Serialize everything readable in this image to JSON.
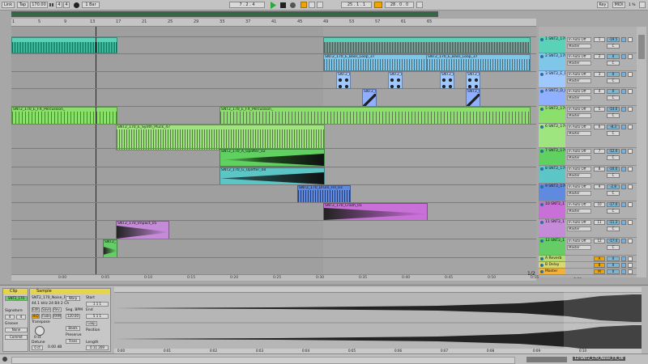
{
  "topbar": {
    "link": "Link",
    "tap": "Tap",
    "tempo": "170.00",
    "sig_num": "4",
    "sig_den": "4",
    "quantize": "1 Bar",
    "position": "7 .  2 .  4",
    "loop_start": "25 .  1 .  1",
    "loop_len": "28 .  0 .  0",
    "key": "Key",
    "midi": "MIDI",
    "cpu": "1 %"
  },
  "ruler": {
    "bars": [
      "1",
      "5",
      "9",
      "13",
      "17",
      "21",
      "25",
      "29",
      "33",
      "37",
      "41",
      "45",
      "49",
      "53",
      "57",
      "61",
      "65"
    ]
  },
  "timebar": {
    "times": [
      "0:00",
      "0:05",
      "0:10",
      "0:15",
      "0:20",
      "0:25",
      "0:30",
      "0:35",
      "0:40",
      "0:45",
      "0:50",
      "0:55",
      "1:00"
    ],
    "page": "1/2"
  },
  "tracks": [
    {
      "num": "1",
      "name": "1 SNT2_170",
      "color": "#5ad2b8",
      "vol": "-19.5",
      "pan": "C",
      "mon": "Master"
    },
    {
      "num": "2",
      "name": "2 SNT2_170",
      "color": "#7fc6e8",
      "vol": "0",
      "pan": "C",
      "mon": "Master"
    },
    {
      "num": "3",
      "name": "3 SNT2_E_B",
      "color": "#9fc8ff",
      "vol": "0",
      "pan": "C",
      "mon": "Master"
    },
    {
      "num": "4",
      "name": "4 SNT2_D_B",
      "color": "#8fb0ff",
      "vol": "0",
      "pan": "C",
      "mon": "Master"
    },
    {
      "num": "5",
      "name": "5 SNT2_170",
      "color": "#8ae06a",
      "vol": "-14.0",
      "pan": "C",
      "mon": "Master"
    },
    {
      "num": "6",
      "name": "6 SNT2_170",
      "color": "#9ee57f",
      "vol": "-8.3",
      "pan": "C",
      "mon": "Master"
    },
    {
      "num": "7",
      "name": "7 SNT2_170",
      "color": "#60d060",
      "vol": "-12.0",
      "pan": "C",
      "mon": "Master"
    },
    {
      "num": "8",
      "name": "8 SNT2_170",
      "color": "#5cc6c6",
      "vol": "-10.0",
      "pan": "C",
      "mon": "Master"
    },
    {
      "num": "9",
      "name": "9 SNT2_170",
      "color": "#5f8ae0",
      "vol": "-2.8",
      "pan": "C",
      "mon": "Master"
    },
    {
      "num": "10",
      "name": "10 SNT2_17",
      "color": "#c86fd8",
      "vol": "-17.0",
      "pan": "C",
      "mon": "Master"
    },
    {
      "num": "11",
      "name": "11 SNT2_17",
      "color": "#c58ad8",
      "vol": "-11.3",
      "pan": "C",
      "mon": "Master"
    },
    {
      "num": "12",
      "name": "12 SNT2_17",
      "color": "#66cc66",
      "vol": "-17.4",
      "pan": "C",
      "mon": "Master"
    },
    {
      "num": "A",
      "name": "A Reverb",
      "color": "#b8d873",
      "vol": "0",
      "pan": "C",
      "mon": "Post"
    },
    {
      "num": "B",
      "name": "B Delay",
      "color": "#d8d873",
      "vol": "0",
      "pan": "C",
      "mon": "Post"
    },
    {
      "num": "M",
      "name": "Master",
      "color": "#f2b13c",
      "vol": "0",
      "pan": "C",
      "mon": "1/2"
    }
  ],
  "clips": [
    {
      "label": "SNT2_170_E_Bass_Loop_37",
      "color": "#5ad2b8"
    },
    {
      "label": "SNT2_170_E_Bass_Loop_37",
      "color": "#7fc6e8"
    },
    {
      "label": "SNT2_170_E_Bass_Loop_37",
      "color": "#7fc6e8"
    },
    {
      "label": "SNT2_E",
      "color": "#9fc8ff"
    },
    {
      "label": "SNT2_D",
      "color": "#8fb0ff"
    },
    {
      "label": "SNT2_170_E_FX_Percussion_",
      "color": "#8ae06a"
    },
    {
      "label": "SNT2_170_E_Synth_Pluck_47",
      "color": "#9ee57f"
    },
    {
      "label": "SNT2_170_A_Uplifter_02",
      "color": "#60d060"
    },
    {
      "label": "SNT2_170_G_Uplifter_08",
      "color": "#5cc6c6"
    },
    {
      "label": "SNT2_170_Drum_Fill_03",
      "color": "#5f8ae0"
    },
    {
      "label": "SNT2_170_Crash_01",
      "color": "#c86fd8"
    },
    {
      "label": "SNT2_170_Impact_05",
      "color": "#c58ad8"
    },
    {
      "label": "SNT2_",
      "color": "#66cc66"
    }
  ],
  "detail": {
    "clip_title": "Clip",
    "clip_name": "SNT2_170",
    "signature": "Signature",
    "sig_num": "4",
    "sig_den": "4",
    "groove": "Groove",
    "groove_val": "None",
    "commit": "Commit",
    "sample_title": "Sample",
    "sample_name": "SNT2_170_Noise_F",
    "sample_info": "44.1 kHz 24 Bit 2 Ch",
    "edit": "Edit",
    "save": "Save",
    "rev": "Rev.",
    "hiq": "HiQ",
    "fade": "Fade",
    "ram": "RAM",
    "transpose": "Transpose",
    "transpose_val": "0 st",
    "detune": "Detune",
    "detune_val": "0 ct",
    "gain": "0.00 dB",
    "warp": "Warp",
    "seg_bpm": "Seg. BPM",
    "seg_val": "120.00",
    "beats": "Beats",
    "preserve": "Preserve",
    "trans": "Trans",
    "start": "Start",
    "start_val": "1 1 1",
    "end": "End",
    "end_val": "5 1 1",
    "loop": "Loop",
    "position": "Position",
    "length": "Length",
    "length_val": "0 11 269",
    "wave_times": [
      "0:00",
      "0:01",
      "0:02",
      "0:03",
      "0:04",
      "0:05",
      "0:06",
      "0:07",
      "0:08",
      "0:09",
      "0:10"
    ]
  },
  "status": {
    "right": "12-SNT2_170_Noise_FX_08"
  }
}
